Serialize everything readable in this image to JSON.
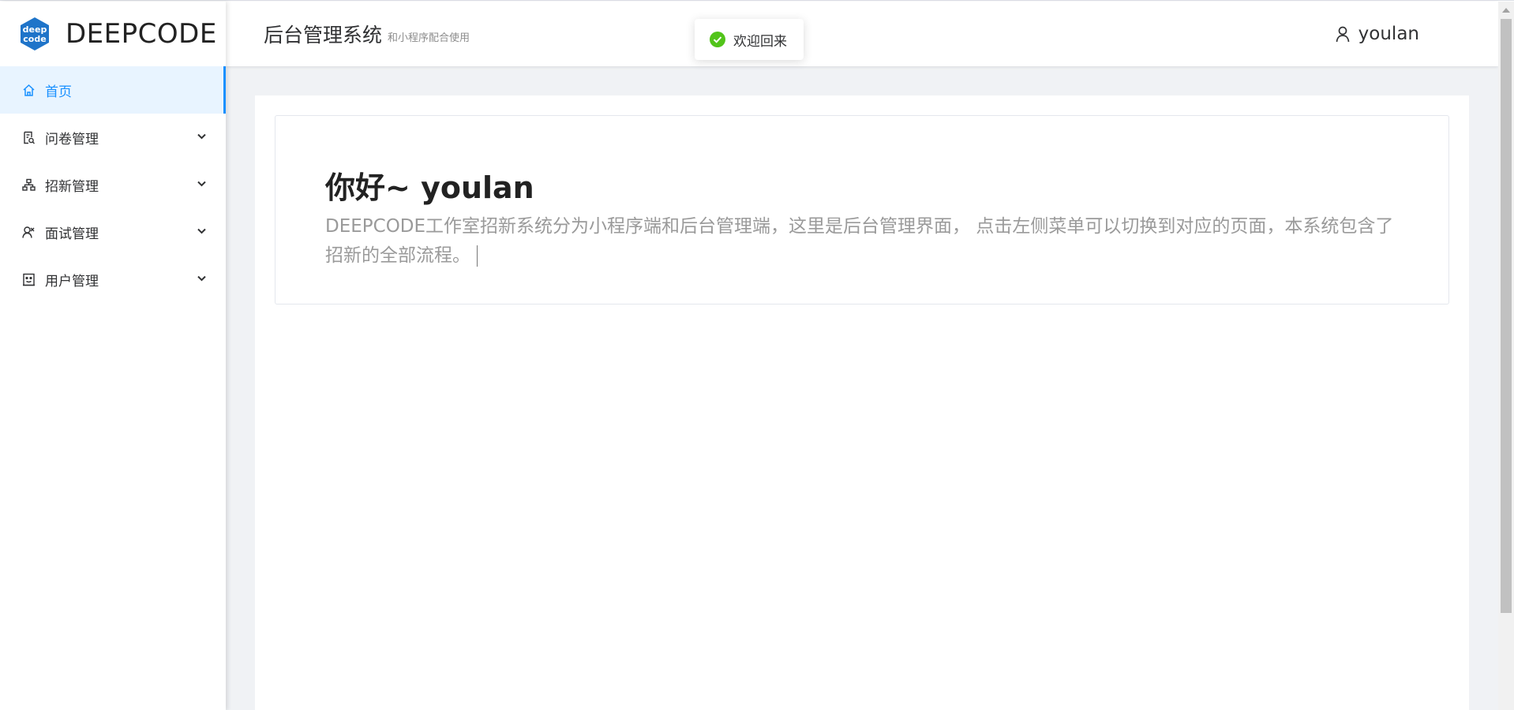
{
  "brand": {
    "logo_line1": "deep",
    "logo_line2": "code",
    "name": "DEEPCODE",
    "logo_color": "#1f74c9"
  },
  "header": {
    "title": "后台管理系统",
    "subtitle": "和小程序配合使用",
    "username": "youlan"
  },
  "toast": {
    "message": "欢迎回来",
    "status_color": "#52c41a"
  },
  "sidebar": {
    "items": [
      {
        "label": "首页",
        "icon": "home-icon",
        "active": true
      },
      {
        "label": "问卷管理",
        "icon": "survey-icon",
        "expandable": true
      },
      {
        "label": "招新管理",
        "icon": "org-tree-icon",
        "expandable": true
      },
      {
        "label": "面试管理",
        "icon": "interview-icon",
        "expandable": true
      },
      {
        "label": "用户管理",
        "icon": "user-badge-icon",
        "expandable": true
      }
    ]
  },
  "content": {
    "greeting": "你好~ youlan",
    "description": "DEEPCODE工作室招新系统分为小程序端和后台管理端，这里是后台管理界面， 点击左侧菜单可以切换到对应的页面，本系统包含了招新的全部流程。"
  },
  "colors": {
    "accent": "#1890ff",
    "active_bg": "#e8f4ff",
    "main_bg": "#f0f2f5"
  }
}
